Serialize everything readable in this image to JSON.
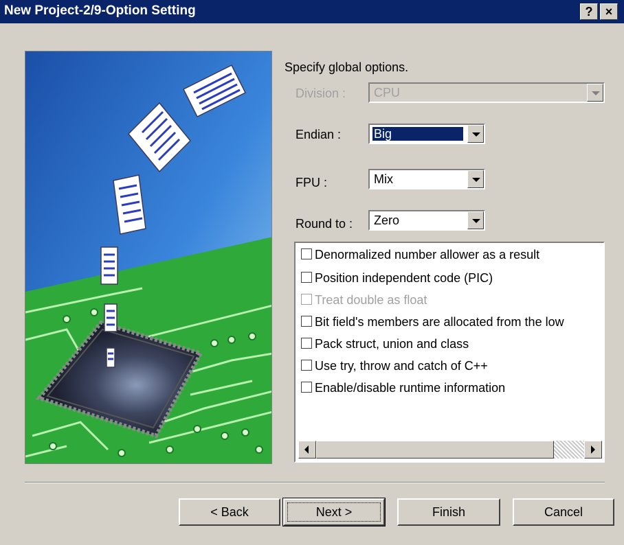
{
  "window": {
    "title": "New Project-2/9-Option Setting",
    "help_glyph": "?",
    "close_glyph": "×"
  },
  "heading": "Specify global options.",
  "fields": {
    "division": {
      "label": "Division :",
      "value": "CPU",
      "enabled": false
    },
    "endian": {
      "label": "Endian :",
      "value": "Big",
      "selected": true
    },
    "fpu": {
      "label": "FPU :",
      "value": "Mix"
    },
    "round_to": {
      "label": "Round to :",
      "value": "Zero"
    }
  },
  "options": [
    {
      "label": "Denormalized number allower as a result",
      "checked": false,
      "enabled": true
    },
    {
      "label": "Position independent code (PIC)",
      "checked": false,
      "enabled": true
    },
    {
      "label": "Treat double as float",
      "checked": false,
      "enabled": false
    },
    {
      "label": "Bit field's members are allocated from the low",
      "checked": false,
      "enabled": true
    },
    {
      "label": "Pack struct, union and class",
      "checked": false,
      "enabled": true
    },
    {
      "label": "Use try, throw and catch of C++",
      "checked": false,
      "enabled": true
    },
    {
      "label": "Enable/disable runtime information",
      "checked": false,
      "enabled": true
    }
  ],
  "buttons": {
    "back": "< Back",
    "next": "Next >",
    "finish": "Finish",
    "cancel": "Cancel"
  },
  "colors": {
    "titlebar": "#0a246a",
    "dialog": "#d4d0c8",
    "selection": "#0a246a",
    "art_sky": "#2f74d0",
    "art_board": "#2faa3a"
  }
}
